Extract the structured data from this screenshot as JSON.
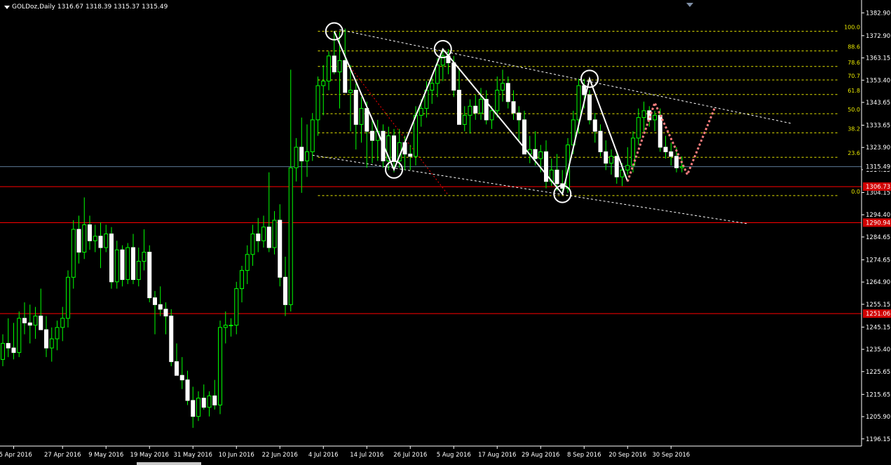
{
  "window": {
    "title": "GOLDoz,Daily",
    "ohlc": "1316.67 1318.39 1315.37 1315.49"
  },
  "colors": {
    "background": "#000000",
    "bull": "#00ff00",
    "bear": "#ffffff",
    "hline": "#ff0000",
    "bid": "#5b7a94",
    "fib": "#e8e800",
    "pattern": "#ffffff",
    "projection": "#ff7f7f",
    "axis": "#ffffff"
  },
  "chart_data": {
    "type": "candlestick",
    "symbol": "GOLDoz",
    "timeframe": "Daily",
    "ylim": [
      1193,
      1387
    ],
    "xlim": [
      0,
      155
    ],
    "price_ticks": [
      "1382.90",
      "1372.90",
      "1363.15",
      "1353.40",
      "1343.65",
      "1333.65",
      "1323.90",
      "1314.15",
      "1304.15",
      "1294.40",
      "1284.65",
      "1274.65",
      "1264.90",
      "1255.15",
      "1245.15",
      "1235.40",
      "1225.65",
      "1215.65",
      "1205.90",
      "1196.15"
    ],
    "date_labels": [
      {
        "i": 2,
        "label": "15 Apr 2016"
      },
      {
        "i": 11,
        "label": "27 Apr 2016"
      },
      {
        "i": 19,
        "label": "9 May 2016"
      },
      {
        "i": 27,
        "label": "19 May 2016"
      },
      {
        "i": 35,
        "label": "31 May 2016"
      },
      {
        "i": 43,
        "label": "10 Jun 2016"
      },
      {
        "i": 51,
        "label": "22 Jun 2016"
      },
      {
        "i": 59,
        "label": "4 Jul 2016"
      },
      {
        "i": 67,
        "label": "14 Jul 2016"
      },
      {
        "i": 75,
        "label": "26 Jul 2016"
      },
      {
        "i": 83,
        "label": "5 Aug 2016"
      },
      {
        "i": 91,
        "label": "17 Aug 2016"
      },
      {
        "i": 99,
        "label": "29 Aug 2016"
      },
      {
        "i": 107,
        "label": "8 Sep 2016"
      },
      {
        "i": 115,
        "label": "20 Sep 2016"
      },
      {
        "i": 123,
        "label": "30 Sep 2016"
      }
    ],
    "horizontal_lines": [
      {
        "price": 1306.73,
        "label": "1306.73"
      },
      {
        "price": 1290.94,
        "label": "1290.94"
      },
      {
        "price": 1251.06,
        "label": "1251.06"
      }
    ],
    "bid": {
      "price": 1315.49,
      "label": "1315.49"
    },
    "fibonacci": {
      "x_from": 58,
      "x_to": 154,
      "levels": [
        {
          "label": "100.0",
          "price": 1374.8
        },
        {
          "label": "88.6",
          "price": 1366.2
        },
        {
          "label": "78.6",
          "price": 1359.4
        },
        {
          "label": "70.7",
          "price": 1353.5
        },
        {
          "label": "61.8",
          "price": 1347.1
        },
        {
          "label": "50.0",
          "price": 1338.7
        },
        {
          "label": "38.2",
          "price": 1330.3
        },
        {
          "label": "23.6",
          "price": 1319.6
        },
        {
          "label": "0.0",
          "price": 1302.8
        }
      ]
    },
    "pattern": [
      {
        "i": 61,
        "p": 1374.8
      },
      {
        "i": 72,
        "p": 1314.2
      },
      {
        "i": 81,
        "p": 1367.0
      },
      {
        "i": 103,
        "p": 1303.5
      },
      {
        "i": 108,
        "p": 1354.0
      },
      {
        "i": 115,
        "p": 1309.0
      }
    ],
    "projection": [
      {
        "i": 115,
        "p": 1309.0
      },
      {
        "i": 120,
        "p": 1343.5
      },
      {
        "i": 126,
        "p": 1312.0
      },
      {
        "i": 131,
        "p": 1341.0
      }
    ],
    "circles": [
      {
        "i": 61,
        "p": 1374.8
      },
      {
        "i": 72,
        "p": 1314.2
      },
      {
        "i": 81,
        "p": 1367.0
      },
      {
        "i": 103,
        "p": 1303.5
      },
      {
        "i": 108,
        "p": 1354.0
      }
    ],
    "channel_lines": [
      {
        "i1": 62,
        "p1": 1375.5,
        "i2": 145,
        "p2": 1334.5
      },
      {
        "i1": 57,
        "p1": 1320.5,
        "i2": 137,
        "p2": 1290.5
      }
    ],
    "red_dotted": {
      "i1": 64,
      "p1": 1359.0,
      "i2": 82,
      "p2": 1303.0
    },
    "candles": [
      [
        1231.0,
        1242.0,
        1228.0,
        1238.0
      ],
      [
        1238.0,
        1249.0,
        1232.0,
        1236.0
      ],
      [
        1236.0,
        1247.0,
        1231.0,
        1234.0
      ],
      [
        1234.0,
        1252.0,
        1232.0,
        1249.0
      ],
      [
        1249.0,
        1256.0,
        1242.0,
        1247.0
      ],
      [
        1247.0,
        1255.0,
        1238.0,
        1246.0
      ],
      [
        1246.0,
        1254.0,
        1240.0,
        1250.0
      ],
      [
        1250.0,
        1262.0,
        1244.0,
        1244.0
      ],
      [
        1244.0,
        1250.0,
        1232.0,
        1236.0
      ],
      [
        1236.0,
        1245.0,
        1230.0,
        1240.0
      ],
      [
        1240.0,
        1248.0,
        1235.0,
        1245.0
      ],
      [
        1245.0,
        1254.0,
        1239.0,
        1249.0
      ],
      [
        1249.0,
        1270.0,
        1245.0,
        1267.0
      ],
      [
        1267.0,
        1292.0,
        1262.0,
        1288.0
      ],
      [
        1288.0,
        1294.0,
        1273.0,
        1278.0
      ],
      [
        1278.0,
        1302.0,
        1275.0,
        1290.0
      ],
      [
        1290.0,
        1294.0,
        1279.0,
        1283.0
      ],
      [
        1283.0,
        1290.0,
        1278.0,
        1285.0
      ],
      [
        1285.0,
        1291.0,
        1271.0,
        1280.0
      ],
      [
        1280.0,
        1290.0,
        1278.0,
        1286.0
      ],
      [
        1286.0,
        1289.0,
        1262.0,
        1265.0
      ],
      [
        1265.0,
        1283.0,
        1262.0,
        1279.0
      ],
      [
        1279.0,
        1281.0,
        1263.0,
        1266.0
      ],
      [
        1266.0,
        1282.0,
        1264.0,
        1280.0
      ],
      [
        1280.0,
        1286.0,
        1264.0,
        1266.0
      ],
      [
        1266.0,
        1280.0,
        1263.0,
        1274.0
      ],
      [
        1274.0,
        1288.0,
        1270.0,
        1278.0
      ],
      [
        1278.0,
        1281.0,
        1256.0,
        1258.0
      ],
      [
        1258.0,
        1261.0,
        1242.0,
        1255.0
      ],
      [
        1255.0,
        1263.0,
        1250.0,
        1253.0
      ],
      [
        1253.0,
        1256.0,
        1242.0,
        1250.0
      ],
      [
        1250.0,
        1253.0,
        1228.0,
        1230.0
      ],
      [
        1230.0,
        1238.0,
        1225.0,
        1224.0
      ],
      [
        1224.0,
        1232.0,
        1218.0,
        1222.0
      ],
      [
        1222.0,
        1226.0,
        1211.0,
        1213.0
      ],
      [
        1213.0,
        1219.0,
        1201.0,
        1206.0
      ],
      [
        1206.0,
        1217.0,
        1204.0,
        1214.0
      ],
      [
        1214.0,
        1220.0,
        1209.0,
        1210.0
      ],
      [
        1210.0,
        1217.0,
        1206.0,
        1215.0
      ],
      [
        1215.0,
        1222.0,
        1209.0,
        1211.0
      ],
      [
        1211.0,
        1248.0,
        1207.0,
        1245.0
      ],
      [
        1245.0,
        1252.0,
        1238.0,
        1246.0
      ],
      [
        1246.0,
        1249.0,
        1241.0,
        1246.0
      ],
      [
        1246.0,
        1265.0,
        1242.0,
        1262.0
      ],
      [
        1262.0,
        1272.0,
        1256.0,
        1270.0
      ],
      [
        1270.0,
        1281.0,
        1264.0,
        1277.0
      ],
      [
        1277.0,
        1290.0,
        1272.0,
        1286.0
      ],
      [
        1286.0,
        1293.0,
        1278.0,
        1283.0
      ],
      [
        1283.0,
        1294.0,
        1280.0,
        1289.0
      ],
      [
        1289.0,
        1313.0,
        1278.0,
        1280.0
      ],
      [
        1280.0,
        1296.0,
        1277.0,
        1292.0
      ],
      [
        1292.0,
        1299.0,
        1263.0,
        1267.0
      ],
      [
        1267.0,
        1276.0,
        1250.0,
        1255.0
      ],
      [
        1255.0,
        1358.0,
        1252.0,
        1315.0
      ],
      [
        1315.0,
        1328.0,
        1309.0,
        1324.0
      ],
      [
        1324.0,
        1337.0,
        1304.0,
        1318.0
      ],
      [
        1318.0,
        1334.0,
        1311.0,
        1322.0
      ],
      [
        1322.0,
        1339.0,
        1318.0,
        1336.0
      ],
      [
        1336.0,
        1355.0,
        1329.0,
        1351.0
      ],
      [
        1351.0,
        1360.0,
        1338.0,
        1353.0
      ],
      [
        1353.0,
        1366.0,
        1349.0,
        1364.0
      ],
      [
        1364.0,
        1375.0,
        1356.0,
        1357.0
      ],
      [
        1357.0,
        1374.5,
        1341.0,
        1362.0
      ],
      [
        1362.0,
        1376.0,
        1350.0,
        1348.0
      ],
      [
        1348.0,
        1360.0,
        1331.0,
        1349.0
      ],
      [
        1349.0,
        1352.0,
        1323.0,
        1334.0
      ],
      [
        1334.0,
        1346.0,
        1326.0,
        1341.0
      ],
      [
        1341.0,
        1344.0,
        1315.0,
        1331.0
      ],
      [
        1331.0,
        1337.0,
        1317.0,
        1327.0
      ],
      [
        1327.0,
        1336.0,
        1318.0,
        1331.0
      ],
      [
        1331.0,
        1334.0,
        1315.0,
        1318.0
      ],
      [
        1318.0,
        1333.0,
        1314.0,
        1329.0
      ],
      [
        1329.0,
        1332.0,
        1313.0,
        1318.0
      ],
      [
        1318.0,
        1332.0,
        1315.0,
        1326.0
      ],
      [
        1326.0,
        1329.0,
        1314.0,
        1321.0
      ],
      [
        1321.0,
        1325.0,
        1314.0,
        1320.0
      ],
      [
        1320.0,
        1342.0,
        1316.0,
        1338.0
      ],
      [
        1338.0,
        1345.0,
        1333.0,
        1341.0
      ],
      [
        1341.0,
        1353.0,
        1337.0,
        1349.0
      ],
      [
        1349.0,
        1356.0,
        1343.0,
        1352.0
      ],
      [
        1352.0,
        1363.0,
        1346.0,
        1360.0
      ],
      [
        1360.0,
        1366.0,
        1353.0,
        1364.0
      ],
      [
        1364.0,
        1367.0,
        1356.0,
        1361.0
      ],
      [
        1361.0,
        1364.0,
        1346.0,
        1349.0
      ],
      [
        1349.0,
        1358.0,
        1340.0,
        1334.0
      ],
      [
        1334.0,
        1342.0,
        1331.0,
        1338.0
      ],
      [
        1338.0,
        1345.0,
        1330.0,
        1342.0
      ],
      [
        1342.0,
        1347.0,
        1336.0,
        1339.0
      ],
      [
        1339.0,
        1350.0,
        1336.0,
        1345.0
      ],
      [
        1345.0,
        1349.0,
        1334.0,
        1336.0
      ],
      [
        1336.0,
        1342.0,
        1332.0,
        1340.0
      ],
      [
        1340.0,
        1355.0,
        1337.0,
        1349.0
      ],
      [
        1349.0,
        1358.0,
        1344.0,
        1352.0
      ],
      [
        1352.0,
        1355.0,
        1341.0,
        1344.0
      ],
      [
        1344.0,
        1349.0,
        1336.0,
        1339.0
      ],
      [
        1339.0,
        1342.0,
        1327.0,
        1336.0
      ],
      [
        1336.0,
        1340.0,
        1325.0,
        1321.0
      ],
      [
        1321.0,
        1329.0,
        1317.0,
        1323.0
      ],
      [
        1323.0,
        1331.0,
        1316.0,
        1319.0
      ],
      [
        1319.0,
        1325.0,
        1313.0,
        1322.0
      ],
      [
        1322.0,
        1327.0,
        1306.0,
        1309.0
      ],
      [
        1309.0,
        1319.0,
        1307.0,
        1314.0
      ],
      [
        1314.0,
        1321.0,
        1305.0,
        1308.0
      ],
      [
        1308.0,
        1314.0,
        1303.0,
        1306.0
      ],
      [
        1306.0,
        1328.0,
        1304.0,
        1325.0
      ],
      [
        1325.0,
        1340.0,
        1321.0,
        1336.0
      ],
      [
        1336.0,
        1354.0,
        1330.0,
        1351.0
      ],
      [
        1351.0,
        1354.0,
        1341.0,
        1347.0
      ],
      [
        1347.0,
        1349.0,
        1334.0,
        1336.0
      ],
      [
        1336.0,
        1339.0,
        1326.0,
        1331.0
      ],
      [
        1331.0,
        1334.0,
        1320.0,
        1322.0
      ],
      [
        1322.0,
        1327.0,
        1314.0,
        1317.0
      ],
      [
        1317.0,
        1323.0,
        1312.0,
        1320.0
      ],
      [
        1320.0,
        1322.0,
        1308.0,
        1311.0
      ],
      [
        1311.0,
        1317.0,
        1307.0,
        1314.0
      ],
      [
        1314.0,
        1324.0,
        1312.0,
        1316.0
      ],
      [
        1316.0,
        1331.0,
        1313.0,
        1328.0
      ],
      [
        1328.0,
        1341.0,
        1325.0,
        1337.0
      ],
      [
        1337.0,
        1344.0,
        1330.0,
        1340.0
      ],
      [
        1340.0,
        1342.0,
        1333.0,
        1336.0
      ],
      [
        1336.0,
        1340.0,
        1331.0,
        1338.0
      ],
      [
        1338.0,
        1341.0,
        1322.0,
        1324.0
      ],
      [
        1324.0,
        1329.0,
        1319.0,
        1322.0
      ],
      [
        1322.0,
        1326.0,
        1316.0,
        1320.0
      ],
      [
        1320.0,
        1324.0,
        1313.0,
        1315.0
      ],
      [
        1315.0,
        1320.0,
        1313.0,
        1315.5
      ]
    ]
  }
}
